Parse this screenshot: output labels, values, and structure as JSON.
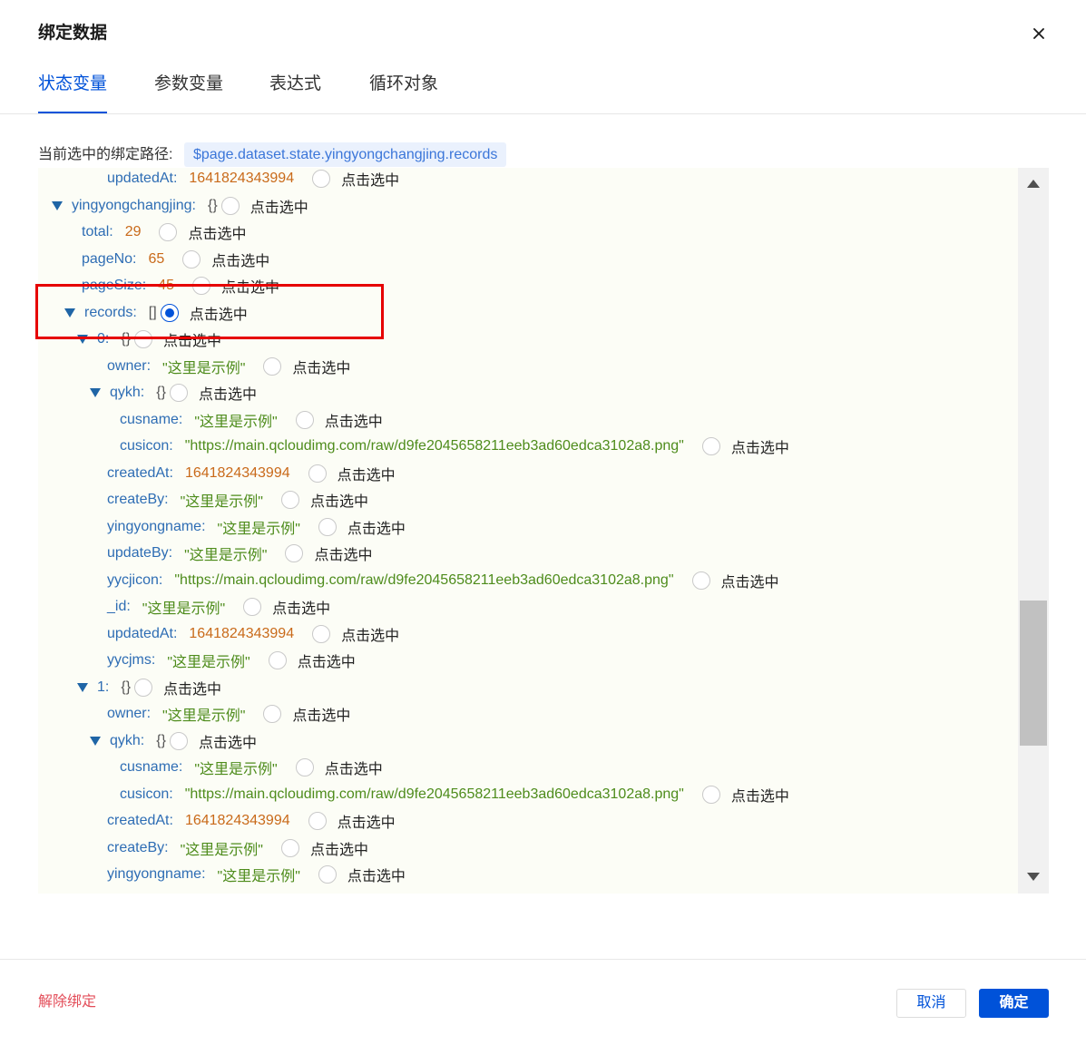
{
  "dialog": {
    "title": "绑定数据"
  },
  "icons": {
    "close": "close-icon",
    "expand": "caret-down-icon",
    "scroll_up": "scroll-up-arrow-icon",
    "scroll_down": "scroll-down-arrow-icon"
  },
  "colors": {
    "accent": "#0052d9",
    "key": "#2e6db4",
    "arrow": "#1f65a6",
    "number": "#c96a1a",
    "string": "#4e8c1c",
    "danger": "#e34d59",
    "highlight": "#e60000"
  },
  "tabs": [
    {
      "label": "状态变量",
      "active": true
    },
    {
      "label": "参数变量",
      "active": false
    },
    {
      "label": "表达式",
      "active": false
    },
    {
      "label": "循环对象",
      "active": false
    }
  ],
  "binding_path": {
    "label": "当前选中的绑定路径:",
    "value": "$page.dataset.state.yingyongchangjing.records"
  },
  "tree": {
    "select_label": "点击选中",
    "rows": [
      {
        "depth": 4,
        "key": "updatedAt:",
        "value": "1641824343994",
        "type": "number"
      },
      {
        "depth": 1,
        "key": "yingyongchangjing:",
        "value": "{}",
        "type": "object",
        "expanded": true
      },
      {
        "depth": 2,
        "key": "total:",
        "value": "29",
        "type": "number"
      },
      {
        "depth": 2,
        "key": "pageNo:",
        "value": "65",
        "type": "number"
      },
      {
        "depth": 2,
        "key": "pageSize:",
        "value": "45",
        "type": "number"
      },
      {
        "depth": 2,
        "key": "records:",
        "value": "[]",
        "type": "array",
        "expanded": true,
        "selected": true
      },
      {
        "depth": 3,
        "key": "0:",
        "value": "{}",
        "type": "object",
        "expanded": true
      },
      {
        "depth": 4,
        "key": "owner:",
        "value": "\"这里是示例\"",
        "type": "string"
      },
      {
        "depth": 4,
        "key": "qykh:",
        "value": "{}",
        "type": "object",
        "expanded": true
      },
      {
        "depth": 5,
        "key": "cusname:",
        "value": "\"这里是示例\"",
        "type": "string"
      },
      {
        "depth": 5,
        "key": "cusicon:",
        "value": "\"https://main.qcloudimg.com/raw/d9fe2045658211eeb3ad60edca3102a8.png\"",
        "type": "string"
      },
      {
        "depth": 4,
        "key": "createdAt:",
        "value": "1641824343994",
        "type": "number"
      },
      {
        "depth": 4,
        "key": "createBy:",
        "value": "\"这里是示例\"",
        "type": "string"
      },
      {
        "depth": 4,
        "key": "yingyongname:",
        "value": "\"这里是示例\"",
        "type": "string"
      },
      {
        "depth": 4,
        "key": "updateBy:",
        "value": "\"这里是示例\"",
        "type": "string"
      },
      {
        "depth": 4,
        "key": "yycjicon:",
        "value": "\"https://main.qcloudimg.com/raw/d9fe2045658211eeb3ad60edca3102a8.png\"",
        "type": "string"
      },
      {
        "depth": 4,
        "key": "_id:",
        "value": "\"这里是示例\"",
        "type": "string"
      },
      {
        "depth": 4,
        "key": "updatedAt:",
        "value": "1641824343994",
        "type": "number"
      },
      {
        "depth": 4,
        "key": "yycjms:",
        "value": "\"这里是示例\"",
        "type": "string"
      },
      {
        "depth": 3,
        "key": "1:",
        "value": "{}",
        "type": "object",
        "expanded": true
      },
      {
        "depth": 4,
        "key": "owner:",
        "value": "\"这里是示例\"",
        "type": "string"
      },
      {
        "depth": 4,
        "key": "qykh:",
        "value": "{}",
        "type": "object",
        "expanded": true
      },
      {
        "depth": 5,
        "key": "cusname:",
        "value": "\"这里是示例\"",
        "type": "string"
      },
      {
        "depth": 5,
        "key": "cusicon:",
        "value": "\"https://main.qcloudimg.com/raw/d9fe2045658211eeb3ad60edca3102a8.png\"",
        "type": "string"
      },
      {
        "depth": 4,
        "key": "createdAt:",
        "value": "1641824343994",
        "type": "number"
      },
      {
        "depth": 4,
        "key": "createBy:",
        "value": "\"这里是示例\"",
        "type": "string"
      },
      {
        "depth": 4,
        "key": "yingyongname:",
        "value": "\"这里是示例\"",
        "type": "string"
      }
    ]
  },
  "footer": {
    "unbind_label": "解除绑定",
    "cancel_label": "取消",
    "confirm_label": "确定"
  }
}
